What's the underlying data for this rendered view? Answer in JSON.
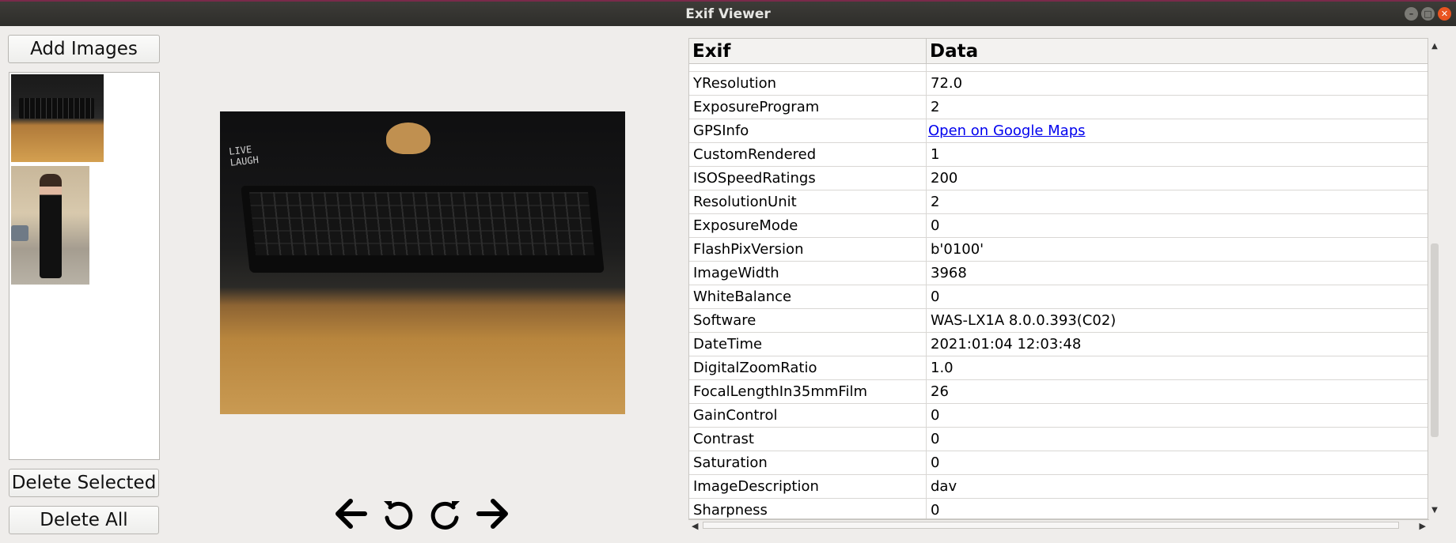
{
  "window": {
    "title": "Exif Viewer"
  },
  "left_panel": {
    "add_images_label": "Add Images",
    "delete_selected_label": "Delete Selected",
    "delete_all_label": "Delete All"
  },
  "image_label": [
    "LIVE",
    "LAUGH"
  ],
  "table": {
    "headers": [
      "Exif",
      "Data"
    ],
    "rows": [
      {
        "key": "YResolution",
        "value": "72.0"
      },
      {
        "key": "ExposureProgram",
        "value": "2"
      },
      {
        "key": "GPSInfo",
        "value": "Open on Google Maps",
        "link": true
      },
      {
        "key": "CustomRendered",
        "value": "1"
      },
      {
        "key": "ISOSpeedRatings",
        "value": "200"
      },
      {
        "key": "ResolutionUnit",
        "value": "2"
      },
      {
        "key": "ExposureMode",
        "value": "0"
      },
      {
        "key": "FlashPixVersion",
        "value": "b'0100'"
      },
      {
        "key": "ImageWidth",
        "value": "3968"
      },
      {
        "key": "WhiteBalance",
        "value": "0"
      },
      {
        "key": "Software",
        "value": "WAS-LX1A 8.0.0.393(C02)"
      },
      {
        "key": "DateTime",
        "value": "2021:01:04 12:03:48"
      },
      {
        "key": "DigitalZoomRatio",
        "value": "1.0"
      },
      {
        "key": "FocalLengthIn35mmFilm",
        "value": "26"
      },
      {
        "key": "GainControl",
        "value": "0"
      },
      {
        "key": "Contrast",
        "value": "0"
      },
      {
        "key": "Saturation",
        "value": "0"
      },
      {
        "key": "ImageDescription",
        "value": "dav"
      },
      {
        "key": "Sharpness",
        "value": "0"
      }
    ]
  },
  "icons": {
    "prev": "arrow-left-icon",
    "rotate_left": "rotate-left-icon",
    "rotate_right": "rotate-right-icon",
    "next": "arrow-right-icon"
  }
}
